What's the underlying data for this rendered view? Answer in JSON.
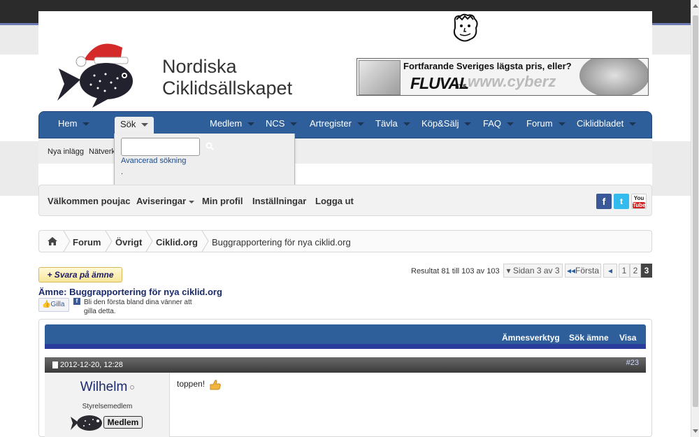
{
  "site": {
    "title_line1": "Nordiska",
    "title_line2": "Ciklidsällskapet"
  },
  "banner": {
    "headline": "Fortfarande Sveriges lägsta pris, eller?",
    "brand": "FLUVAL",
    "model": "FX5",
    "watermark": "www.cyberz"
  },
  "nav": {
    "items": [
      {
        "label": "Hem"
      },
      {
        "label": "Sök"
      },
      {
        "label": "Medlem"
      },
      {
        "label": "NCS"
      },
      {
        "label": "Artregister"
      },
      {
        "label": "Tävla"
      },
      {
        "label": "Köp&Sälj"
      },
      {
        "label": "FAQ"
      },
      {
        "label": "Forum"
      },
      {
        "label": "Ciklidbladet"
      }
    ],
    "active": "Sök"
  },
  "subnav": {
    "items": [
      {
        "label": "Nya inlägg"
      },
      {
        "label": "Nätverk"
      }
    ]
  },
  "search_dropdown": {
    "input_value": "",
    "advanced_label": "Avancerad sökning",
    "dot": "."
  },
  "userbar": {
    "welcome": "Välkommen  poujac",
    "notifications": "Aviseringar",
    "profile": "Min profil",
    "settings": "Inställningar",
    "logout": "Logga ut",
    "social": {
      "facebook": "f",
      "twitter": "t",
      "youtube_top": "You",
      "youtube_bottom": "Tube"
    }
  },
  "breadcrumb": {
    "items": [
      {
        "label": "Forum"
      },
      {
        "label": "Övrigt"
      },
      {
        "label": "Ciklid.org"
      },
      {
        "label": "Buggrapportering för nya ciklid.org"
      }
    ]
  },
  "thread": {
    "reply_label": "+ Svara på ämne",
    "results": "Resultat 81 till 103 av 103",
    "page_info": "Sidan 3 av 3",
    "first_label": "Första",
    "pages": [
      "1",
      "2",
      "3"
    ],
    "current_page": "3",
    "topic_prefix": "Ämne:",
    "topic_title": "Buggrapportering för nya ciklid.org",
    "like_label": "Gilla",
    "like_text": "Bli den första bland dina vänner att gilla detta.",
    "tools": [
      "Ämnesverktyg",
      "Sök ämne",
      "Visa"
    ]
  },
  "post": {
    "date": "2012-12-20, 12:28",
    "number": "#23",
    "username": "Wilhelm",
    "user_title": "Styrelsemedlem",
    "rank_label": "Medlem",
    "body": "toppen!"
  },
  "colors": {
    "nav_blue": "#2e5f9b",
    "accent_bar": "#2b3d9c",
    "link": "#1a2a6a"
  }
}
